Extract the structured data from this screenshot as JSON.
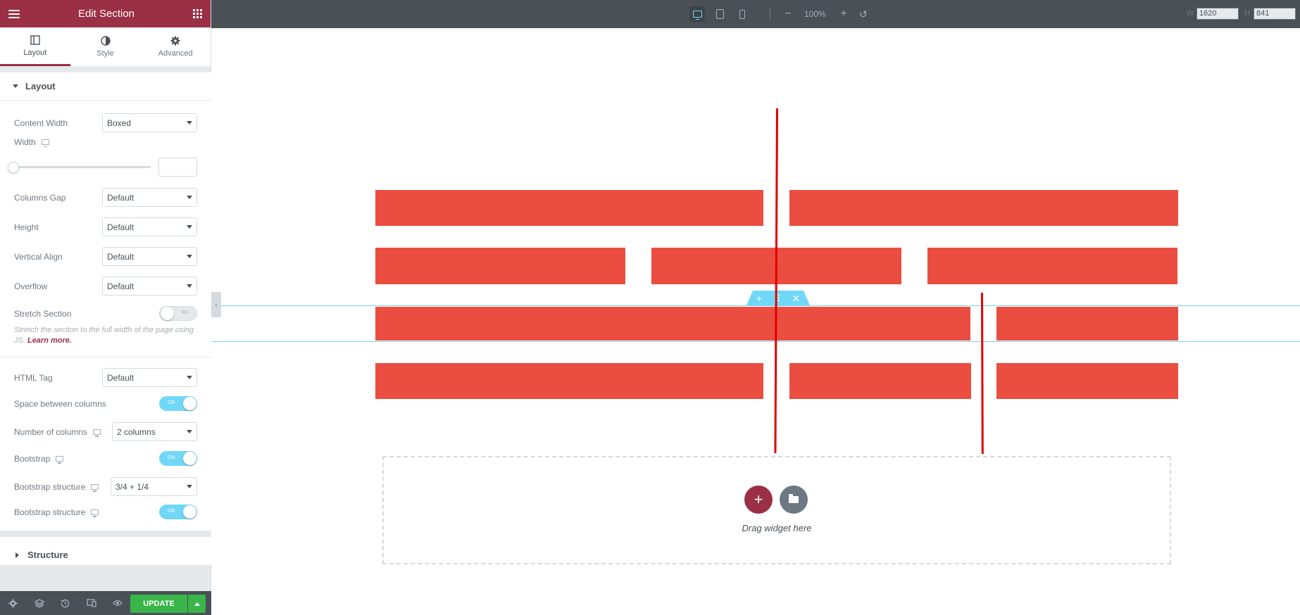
{
  "panel": {
    "title": "Edit Section",
    "tabs": [
      {
        "label": "Layout",
        "icon": "layout-icon"
      },
      {
        "label": "Style",
        "icon": "half-circle-icon"
      },
      {
        "label": "Advanced",
        "icon": "gear-icon"
      }
    ],
    "layout_section": "Layout",
    "controls": {
      "content_width": {
        "label": "Content Width",
        "value": "Boxed"
      },
      "width": {
        "label": "Width"
      },
      "columns_gap": {
        "label": "Columns Gap",
        "value": "Default"
      },
      "height": {
        "label": "Height",
        "value": "Default"
      },
      "vertical_align": {
        "label": "Vertical Align",
        "value": "Default"
      },
      "overflow": {
        "label": "Overflow",
        "value": "Default"
      },
      "stretch_section": {
        "label": "Stretch Section",
        "state": "NO"
      },
      "stretch_help": "Stretch the section to the full width of the page using JS.",
      "learn_more": "Learn more.",
      "html_tag": {
        "label": "HTML Tag",
        "value": "Default"
      },
      "space_between_columns": {
        "label": "Space between columns",
        "state": "ON"
      },
      "number_of_columns": {
        "label": "Number of columns",
        "value": "2 columns"
      },
      "bootstrap": {
        "label": "Bootstrap",
        "state": "ON"
      },
      "bootstrap_structure": {
        "label": "Bootstrap structure",
        "value": "3/4 + 1/4"
      },
      "bootstrap_structure_2": {
        "label": "Bootstrap structure",
        "state": "ON"
      }
    },
    "structure_section": "Structure",
    "footer": {
      "update_label": "UPDATE"
    }
  },
  "topbar": {
    "zoom": "100%",
    "width_label": "W",
    "width_value": "1620",
    "height_label": "H",
    "height_value": "841"
  },
  "canvas": {
    "drag_text": "Drag widget here"
  },
  "colors": {
    "brand": "#9b2f45",
    "bar": "#eb4d41",
    "accent": "#71d7f7",
    "update": "#39b54a"
  }
}
